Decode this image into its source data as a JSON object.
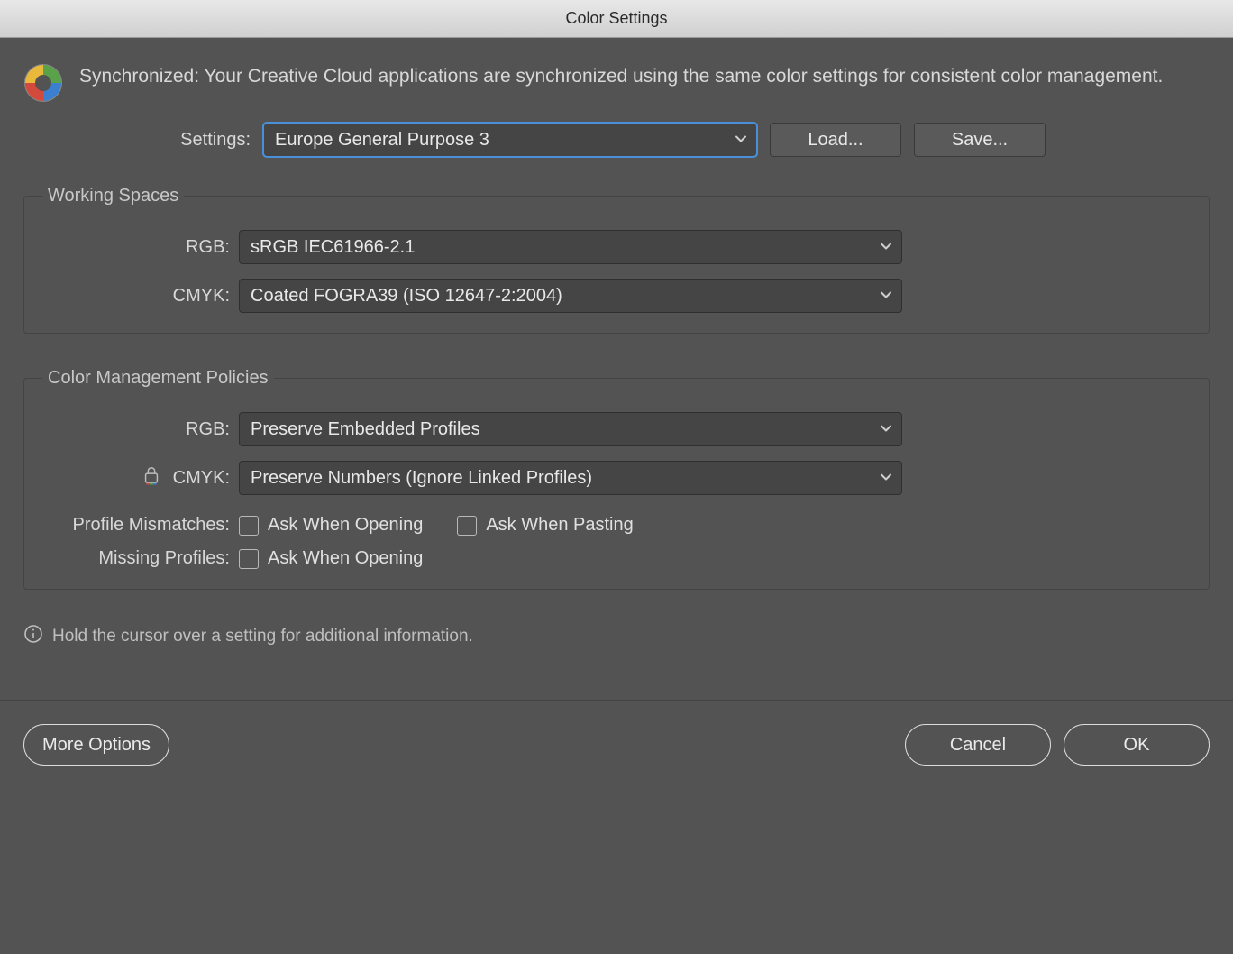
{
  "window": {
    "title": "Color Settings"
  },
  "sync_message": "Synchronized: Your Creative Cloud applications are synchronized using the same color settings for consistent color management.",
  "settings": {
    "label": "Settings:",
    "value": "Europe General Purpose 3",
    "load_label": "Load...",
    "save_label": "Save..."
  },
  "working_spaces": {
    "legend": "Working Spaces",
    "rgb_label": "RGB:",
    "rgb_value": "sRGB IEC61966-2.1",
    "cmyk_label": "CMYK:",
    "cmyk_value": "Coated FOGRA39 (ISO 12647-2:2004)"
  },
  "policies": {
    "legend": "Color Management Policies",
    "rgb_label": "RGB:",
    "rgb_value": "Preserve Embedded Profiles",
    "cmyk_label": "CMYK:",
    "cmyk_value": "Preserve Numbers (Ignore Linked Profiles)",
    "mismatch_label": "Profile Mismatches:",
    "mismatch_open": "Ask When Opening",
    "mismatch_paste": "Ask When Pasting",
    "missing_label": "Missing Profiles:",
    "missing_open": "Ask When Opening"
  },
  "info_hint": "Hold the cursor over a setting for additional information.",
  "footer": {
    "more_options": "More Options",
    "cancel": "Cancel",
    "ok": "OK"
  }
}
